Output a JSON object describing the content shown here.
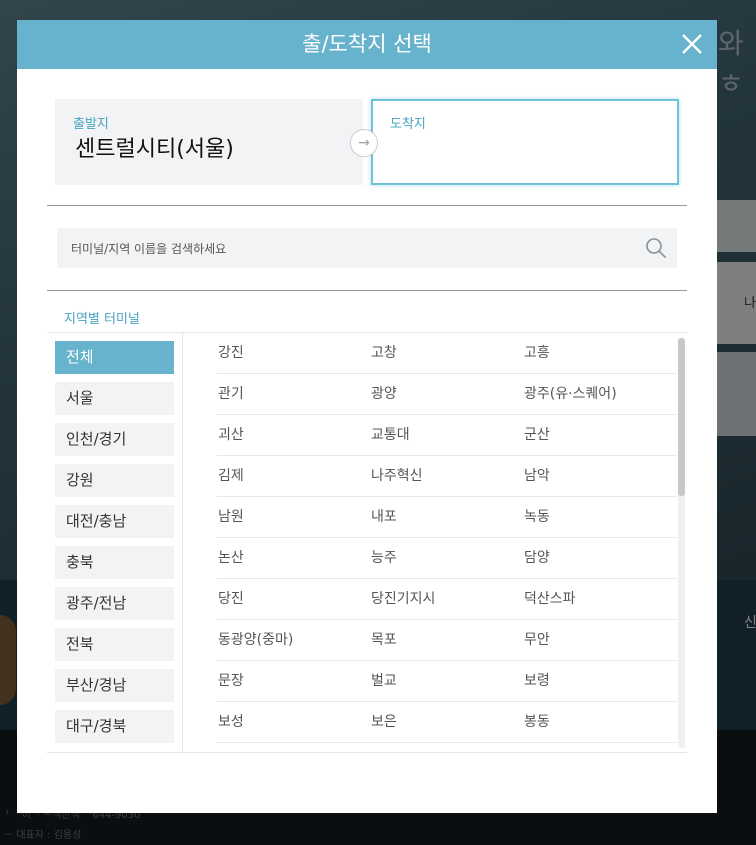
{
  "modal": {
    "title": "출/도착지 선택"
  },
  "route": {
    "departure_label": "출발지",
    "departure_value": "센트럴시티(서울)",
    "arrival_label": "도착지",
    "arrival_value": ""
  },
  "search": {
    "placeholder": "터미널/지역 이름을 검색하세요"
  },
  "regions": {
    "title": "지역별 터미널",
    "items": [
      "전체",
      "서울",
      "인천/경기",
      "강원",
      "대전/충남",
      "충북",
      "광주/전남",
      "전북",
      "부산/경남",
      "대구/경북"
    ],
    "active_index": 0
  },
  "terminals": {
    "rows": [
      [
        "강진",
        "고창",
        "고흥"
      ],
      [
        "관기",
        "광양",
        "광주(유·스퀘어)"
      ],
      [
        "괴산",
        "교통대",
        "군산"
      ],
      [
        "김제",
        "나주혁신",
        "남악"
      ],
      [
        "남원",
        "내포",
        "녹동"
      ],
      [
        "논산",
        "능주",
        "담양"
      ],
      [
        "당진",
        "당진기지시",
        "덕산스파"
      ],
      [
        "동광양(중마)",
        "목포",
        "무안"
      ],
      [
        "문장",
        "벌교",
        "보령"
      ],
      [
        "보성",
        "보은",
        "봉동"
      ]
    ]
  },
  "background": {
    "header_text": "와 ㅎ",
    "side_text": "나",
    "right_label": "신",
    "footer_line1": "ᅡ    ᅡ이ᅥ     ᅩ식반식 ᅵ644-9030",
    "footer_line2": "ᅳ 대표자 : 김용성"
  },
  "colors": {
    "accent": "#67b2cc",
    "accent_text": "#4aa3c1",
    "overlay": "rgba(0,0,0,0.45)"
  },
  "icons": {
    "close": "close-icon",
    "swap": "swap-arrow-icon",
    "search": "search-icon"
  }
}
